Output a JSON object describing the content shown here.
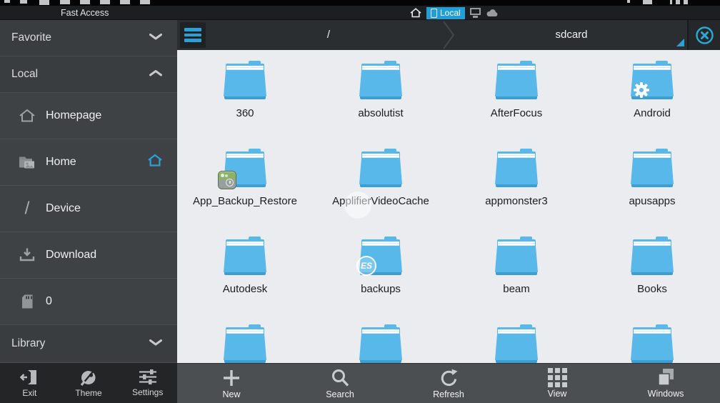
{
  "titlebar": {
    "title": "Fast Access",
    "local_tab_label": "Local"
  },
  "breadcrumb": {
    "root": "/",
    "current": "sdcard"
  },
  "sidebar": {
    "rows": [
      {
        "type": "header",
        "label": "Favorite",
        "icon": "chevron-down-icon"
      },
      {
        "type": "header",
        "label": "Local",
        "icon": "chevron-up-icon"
      },
      {
        "type": "item",
        "label": "Homepage",
        "icon": "home-outline-icon"
      },
      {
        "type": "item",
        "label": "Home",
        "icon": "folder-image-icon",
        "trailing_icon": "home-blue-icon"
      },
      {
        "type": "item",
        "label": "Device",
        "icon": "slash-icon"
      },
      {
        "type": "item",
        "label": "Download",
        "icon": "download-icon"
      },
      {
        "type": "item",
        "label": "0",
        "icon": "sdcard-icon"
      },
      {
        "type": "header",
        "label": "Library",
        "icon": "chevron-down-icon"
      }
    ]
  },
  "left_toolbar": {
    "items": [
      {
        "label": "Exit",
        "icon": "exit-icon"
      },
      {
        "label": "Theme",
        "icon": "theme-icon"
      },
      {
        "label": "Settings",
        "icon": "settings-icon"
      }
    ]
  },
  "toolbar": {
    "items": [
      {
        "label": "New",
        "icon": "plus-icon"
      },
      {
        "label": "Search",
        "icon": "search-icon"
      },
      {
        "label": "Refresh",
        "icon": "refresh-icon"
      },
      {
        "label": "View",
        "icon": "grid-view-icon"
      },
      {
        "label": "Windows",
        "icon": "windows-icon"
      }
    ]
  },
  "grid": {
    "items": [
      {
        "name": "360",
        "badge": null
      },
      {
        "name": "absolutist",
        "badge": null
      },
      {
        "name": "AfterFocus",
        "badge": null
      },
      {
        "name": "Android",
        "badge": "gear"
      },
      {
        "name": "App_Backup_Restore",
        "badge": "app"
      },
      {
        "name": "ApplifierVideoCache",
        "badge": null
      },
      {
        "name": "appmonster3",
        "badge": null
      },
      {
        "name": "apusapps",
        "badge": null
      },
      {
        "name": "Autodesk",
        "badge": null
      },
      {
        "name": "backups",
        "badge": "es"
      },
      {
        "name": "beam",
        "badge": null
      },
      {
        "name": "Books",
        "badge": null
      },
      {
        "name": "",
        "badge": null
      },
      {
        "name": "",
        "badge": null
      },
      {
        "name": "",
        "badge": null
      },
      {
        "name": "",
        "badge": null
      }
    ]
  },
  "icons": {
    "slash_glyph": "/",
    "es_badge_label": "ES"
  },
  "colors": {
    "accent": "#2ba2d8",
    "folder_blue": "#58b8e9",
    "folder_dark_blue": "#3d9ed3",
    "content_bg": "#eaecef",
    "sidebar_bg": "#3f4245",
    "toolbar_bg": "#4c4f52",
    "titlebar_bg": "#1c1e20",
    "local_tab_bg": "#1f9ed8"
  }
}
